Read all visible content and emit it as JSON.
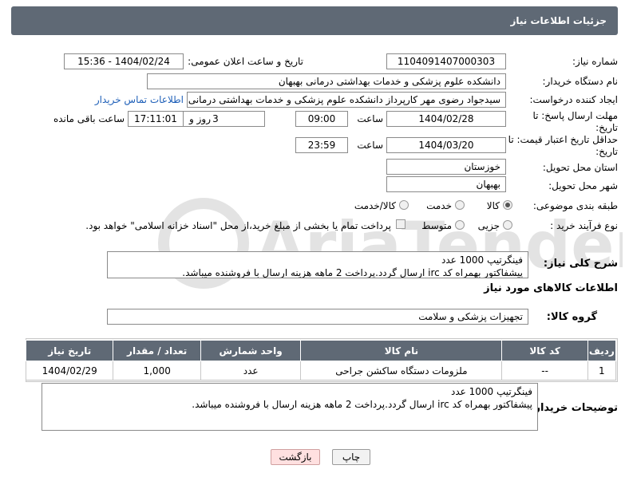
{
  "header": {
    "title": "جزئیات اطلاعات نیاز"
  },
  "form": {
    "need_number_label": "شماره نیاز:",
    "need_number": "1104091407000303",
    "announce_label": "تاریخ و ساعت اعلان عمومی:",
    "announce_value": "1404/02/24 - 15:36",
    "buyer_label": "نام دستگاه خریدار:",
    "buyer_value": "دانشکده علوم پزشکی و خدمات بهداشتی  درمانی بهبهان",
    "creator_label": "ایجاد کننده درخواست:",
    "creator_value": "سیدجواد رضوی مهر کارپرداز دانشکده علوم پزشکی و خدمات بهداشتی  درمانی",
    "contact_link": "اطلاعات تماس خریدار",
    "deadline_label": "مهلت ارسال پاسخ: تا تاریخ:",
    "deadline_date": "1404/02/28",
    "time_label": "ساعت",
    "deadline_time": "09:00",
    "days_value": "3",
    "days_label": "روز و",
    "remaining_time": "17:11:01",
    "remaining_label": "ساعت باقی مانده",
    "min_price_label": "حداقل تاریخ اعتبار قیمت: تا تاریخ:",
    "price_date": "1404/03/20",
    "price_time_label": "ساعت",
    "price_time": "23:59",
    "province_label": "استان محل تحویل:",
    "province_value": "خوزستان",
    "city_label": "شهر محل تحویل:",
    "city_value": "بهبهان",
    "category_label": "طبقه بندی موضوعی:",
    "category_options": [
      "کالا",
      "خدمت",
      "کالا/خدمت"
    ],
    "process_label": "نوع فرآیند خرید :",
    "process_options": [
      "جزیی",
      "متوسط"
    ],
    "process_note": "پرداخت تمام یا بخشی از مبلغ خرید،از محل \"اسناد خزانه اسلامی\" خواهد بود."
  },
  "description": {
    "label": "شرح کلی نیاز:",
    "line1": "فینگرتیپ 1000 عدد",
    "line2": "پیشفاکتور بهمراه کد irc ارسال گردد.پرداخت 2 ماهه هزینه ارسال با فروشنده میباشد."
  },
  "goods": {
    "section_title": "اطلاعات کالاهای مورد نیاز",
    "group_label": "گروه کالا:",
    "group_value": "تجهیزات پزشکی و سلامت",
    "columns": [
      "ردیف",
      "کد کالا",
      "نام کالا",
      "واحد شمارش",
      "تعداد / مقدار",
      "تاریخ نیاز"
    ],
    "rows": [
      [
        "1",
        "--",
        "ملزومات دستگاه ساکشن جراحی",
        "عدد",
        "1,000",
        "1404/02/29"
      ]
    ]
  },
  "buyer_notes": {
    "label": "توضیحات خریدار:",
    "line1": "فینگرتیپ 1000 عدد",
    "line2": "پیشفاکتور بهمراه کد irc ارسال گردد.پرداخت 2 ماهه هزینه ارسال با فروشنده میباشد."
  },
  "buttons": {
    "print": "چاپ",
    "back": "بازگشت"
  },
  "watermark": {
    "text": "AriaTender.neT"
  }
}
